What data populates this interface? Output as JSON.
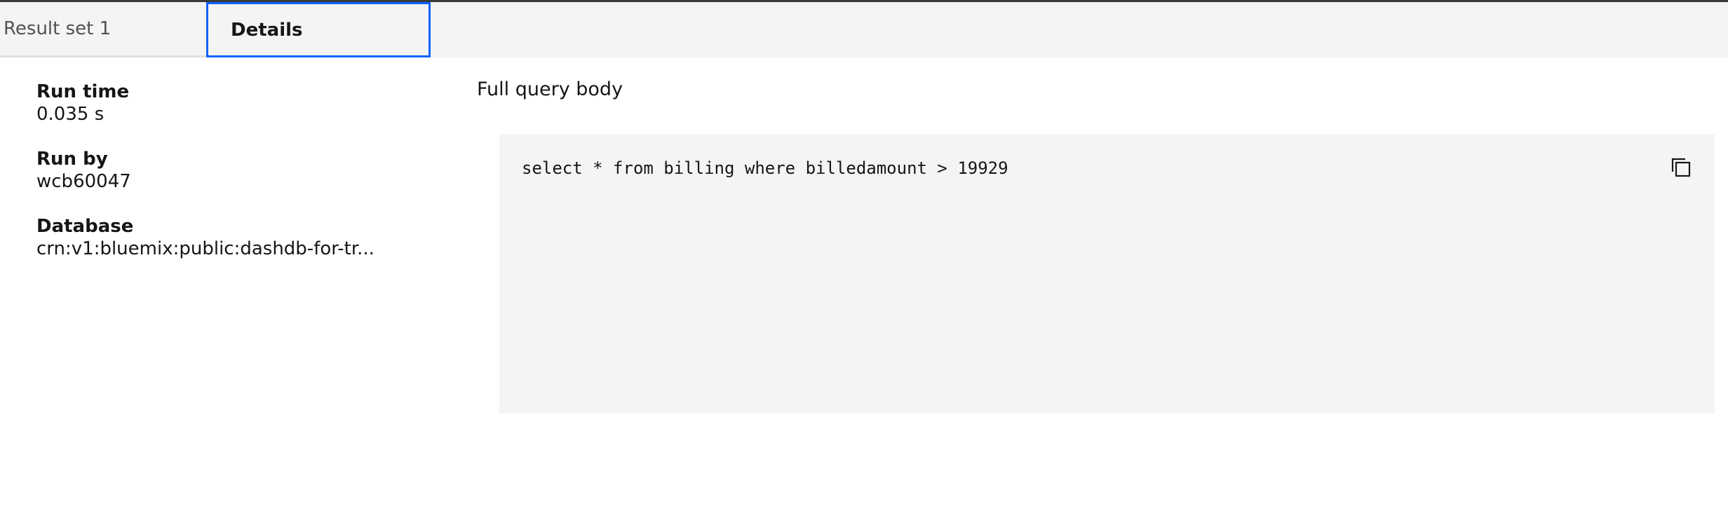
{
  "tabs": {
    "result_set": "Result set 1",
    "details": "Details"
  },
  "details": {
    "run_time_label": "Run time",
    "run_time_value": "0.035 s",
    "run_by_label": "Run by",
    "run_by_value": "wcb60047",
    "database_label": "Database",
    "database_value": "crn:v1:bluemix:public:dashdb-for-tr..."
  },
  "query": {
    "label": "Full query body",
    "body": "select * from billing where billedamount > 19929"
  },
  "icons": {
    "copy": "copy-icon"
  },
  "colors": {
    "active_tab_border": "#0f62fe",
    "code_background": "#f4f4f4"
  }
}
